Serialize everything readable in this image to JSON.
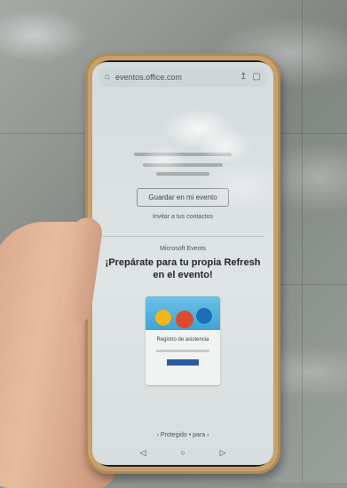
{
  "browser": {
    "address": "eventos.office.com",
    "icons": [
      "home-icon",
      "share-icon",
      "tabs-icon"
    ]
  },
  "page": {
    "button_label": "Guardar en mi evento",
    "link_text": "Invitar a tus contactos",
    "event_label": "Microsoft Events",
    "headline": "¡Prepárate para tu propia Refresh en el evento!",
    "card_text": "Registro de asistencia",
    "footer_link": "‹ Protegido • para ›"
  },
  "navbar": {
    "icons": [
      "back-icon",
      "home-circle-icon",
      "recents-icon"
    ]
  },
  "colors": {
    "phone_frame": "#c7a06b",
    "card_button": "#2c5aa0"
  }
}
